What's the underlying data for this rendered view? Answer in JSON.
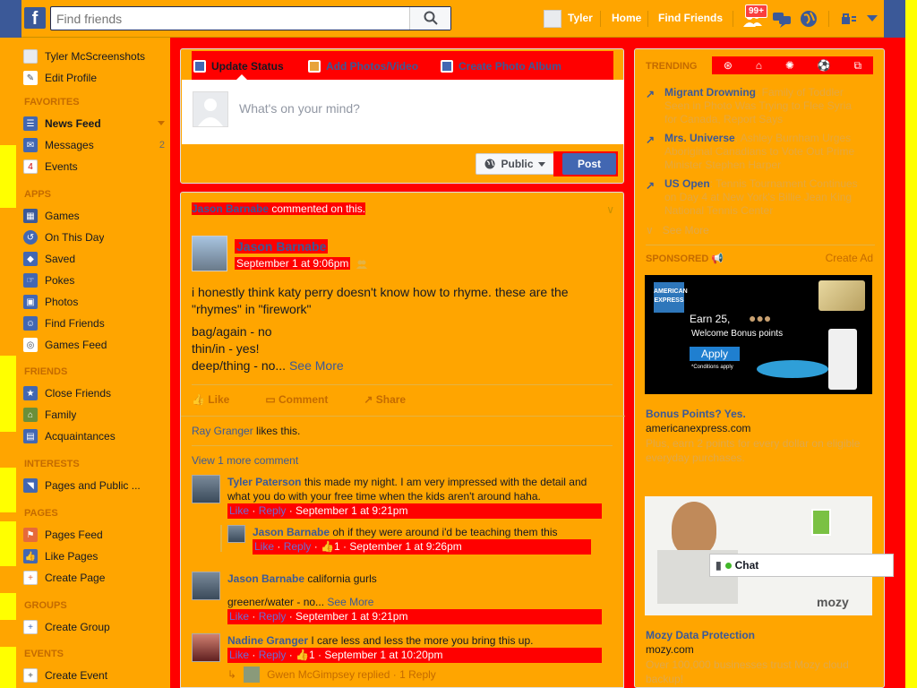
{
  "topbar": {
    "logo": "f",
    "search_placeholder": "Find friends",
    "user_name": "Tyler",
    "nav_home": "Home",
    "nav_find_friends": "Find Friends",
    "friend_requests_badge": "99+"
  },
  "sidebar": {
    "profile_name": "Tyler McScreenshots",
    "edit_profile": "Edit Profile",
    "favorites_head": "FAVORITES",
    "news_feed": "News Feed",
    "messages": "Messages",
    "messages_count": "2",
    "events": "Events",
    "apps_head": "APPS",
    "games": "Games",
    "on_this_day": "On This Day",
    "saved": "Saved",
    "pokes": "Pokes",
    "photos": "Photos",
    "find_friends": "Find Friends",
    "games_feed": "Games Feed",
    "friends_head": "FRIENDS",
    "close_friends": "Close Friends",
    "family": "Family",
    "acquaintances": "Acquaintances",
    "interests_head": "INTERESTS",
    "pages_public": "Pages and Public ...",
    "pages_head": "PAGES",
    "pages_feed": "Pages Feed",
    "like_pages": "Like Pages",
    "create_page": "Create Page",
    "groups_head": "GROUPS",
    "create_group": "Create Group",
    "events_head": "EVENTS",
    "create_event": "Create Event"
  },
  "composer": {
    "tab_status": "Update Status",
    "tab_photos": "Add Photos/Video",
    "tab_album": "Create Photo Album",
    "placeholder": "What's on your mind?",
    "privacy": "Public",
    "post": "Post"
  },
  "story": {
    "header_name": "Jason Barnabe",
    "header_action": " commented on this.",
    "author": "Jason Barnabe",
    "timestamp": "September 1 at 9:06pm",
    "line1": "i honestly think katy perry doesn't know how to rhyme. these are the \"rhymes\" in \"firework\"",
    "line2": "bag/again - no",
    "line3": "thin/in - yes!",
    "line4": "deep/thing - no... ",
    "see_more": "See More",
    "like": "Like",
    "comment": "Comment",
    "share": "Share",
    "likes_name": "Ray Granger",
    "likes_suffix": " likes this.",
    "view_more": "View 1 more comment"
  },
  "comments": [
    {
      "name": "Tyler Paterson",
      "text": " this made my night. I am very impressed with the detail and what you do with your free time when the kids aren't around haha.",
      "meta_like": "Like",
      "meta_reply": "Reply",
      "meta_time": "September 1 at 9:21pm"
    },
    {
      "name": "Jason Barnabe",
      "text": " oh if they were around i'd be teaching them this",
      "meta_like": "Like",
      "meta_reply": "Reply",
      "likes": "1",
      "meta_time": "September 1 at 9:26pm"
    },
    {
      "name": "Jason Barnabe",
      "text": " california gurls",
      "text2": "greener/water - no... ",
      "see_more": "See More",
      "meta_like": "Like",
      "meta_reply": "Reply",
      "meta_time": "September 1 at 9:21pm"
    },
    {
      "name": "Nadine Granger",
      "text": " I care less and less the more you bring this up.",
      "meta_like": "Like",
      "meta_reply": "Reply",
      "likes": "1",
      "meta_time": "September 1 at 10:20pm",
      "reply_summary": "Gwen McGimpsey replied · 1 Reply"
    }
  ],
  "right": {
    "trending_head": "TRENDING",
    "trends": [
      {
        "title": "Migrant Drowning",
        "desc": ": Family of Toddler Seen in Photo Was Trying to Flee Syria for Canada, Report Says"
      },
      {
        "title": "Mrs. Universe",
        "desc": ": Ashley Burnham Urges Aboriginal Canadians to Vote Out Prime Minister Stephen Harper"
      },
      {
        "title": "US Open",
        "desc": ": Tennis Tournament Continues on Day 4 at New York's Billie Jean King National Tennis Center"
      }
    ],
    "see_more": "See More",
    "sponsored_head": "SPONSORED",
    "create_ad": "Create Ad",
    "ad1_earn": "Earn 25,",
    "ad1_welcome": "Welcome Bonus points",
    "ad1_apply": "Apply",
    "ad1_conditions": "*Conditions apply",
    "ad1_title": "Bonus Points? Yes.",
    "ad1_domain": "americanexpress.com",
    "ad1_desc": "Plus, earn 2 points for every dollar on eligible everyday purchases.",
    "ad2_brand": "mozy",
    "ad2_title": "Mozy Data Protection",
    "ad2_domain": "mozy.com",
    "ad2_desc": "Over 100,000 businesses trust Mozy cloud backup!"
  },
  "chat": {
    "label": "Chat"
  }
}
